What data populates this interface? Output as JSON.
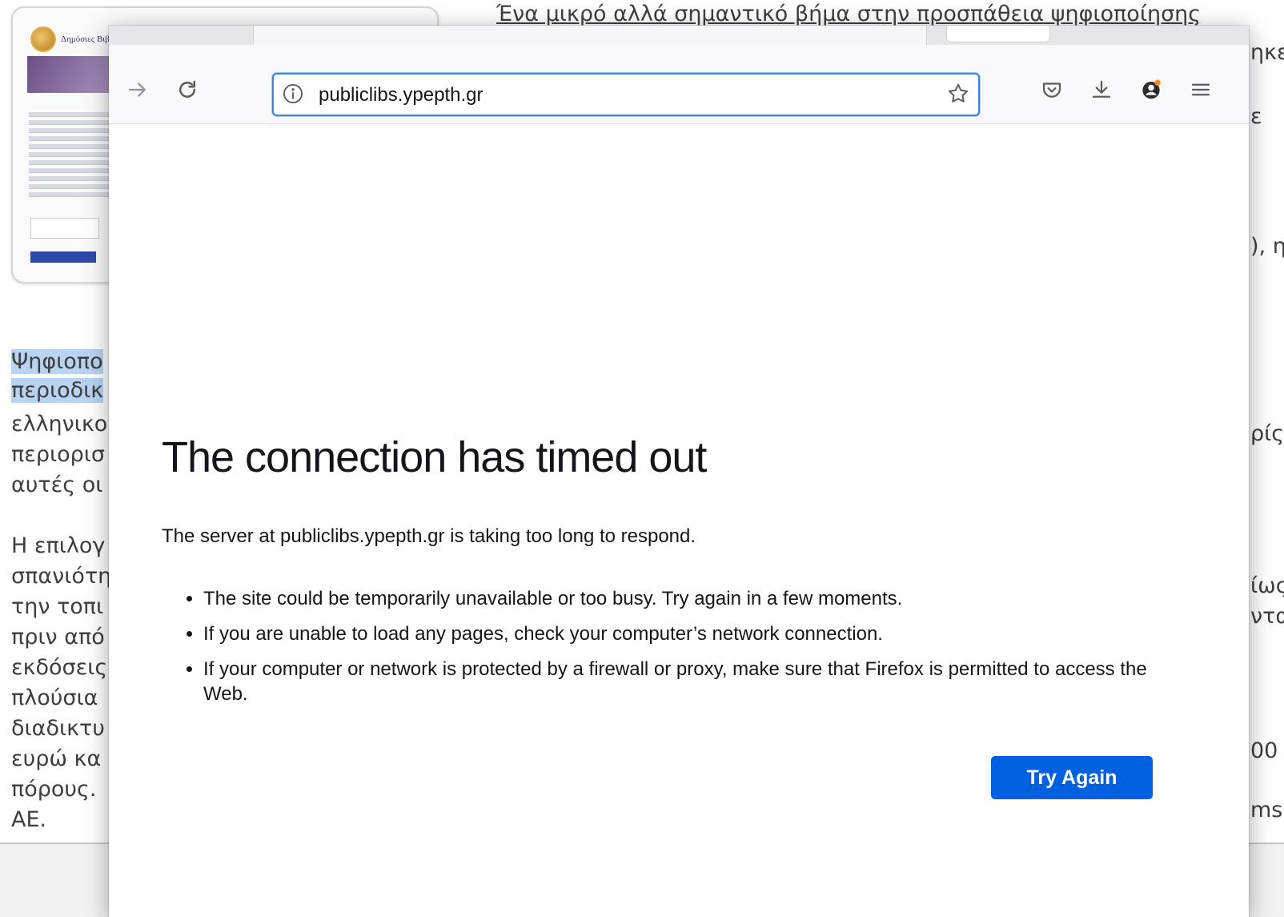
{
  "browser": {
    "url": "publiclibs.ypepth.gr",
    "nav": {
      "forward_icon": "arrow-right-icon",
      "reload_icon": "reload-icon"
    },
    "toolbar_icons": [
      "pocket-icon",
      "download-icon",
      "account-icon",
      "menu-icon"
    ]
  },
  "error_page": {
    "title": "The connection has timed out",
    "description": "The server at publiclibs.ypepth.gr is taking too long to respond.",
    "items": [
      "The site could be temporarily unavailable or too busy. Try again in a few moments.",
      "If you are unable to load any pages, check your computer’s network connection.",
      "If your computer or network is protected by a firewall or proxy, make sure that Firefox is permitted to access the Web."
    ],
    "button_label": "Try Again"
  },
  "background_page": {
    "thumbnail_title": "Δημόσιες Βιβλ",
    "top_link": "Ένα μικρό αλλά σημαντικό βήμα στην προσπάθεια ψηφιοποίησης",
    "right_fragments": [
      "ηκε",
      "ε",
      "), η",
      "ρίς",
      "ίως",
      "ντα",
      "00",
      "ms"
    ],
    "left_fragments": [
      "Ψηφιοπο",
      "περιοδικ",
      "ελληνικο",
      "περιορισ",
      "αυτές οι",
      "Η επιλογ",
      "σπανιότη",
      "την τοπι",
      "πριν από",
      "εκδόσεις",
      "πλούσια",
      "διαδικτυ",
      "ευρώ κα",
      "πόρους.",
      "ΑΕ."
    ]
  },
  "colors": {
    "accent": "#0061e0",
    "url_focus": "#3d85dc",
    "highlight": "#b9d3f3"
  }
}
